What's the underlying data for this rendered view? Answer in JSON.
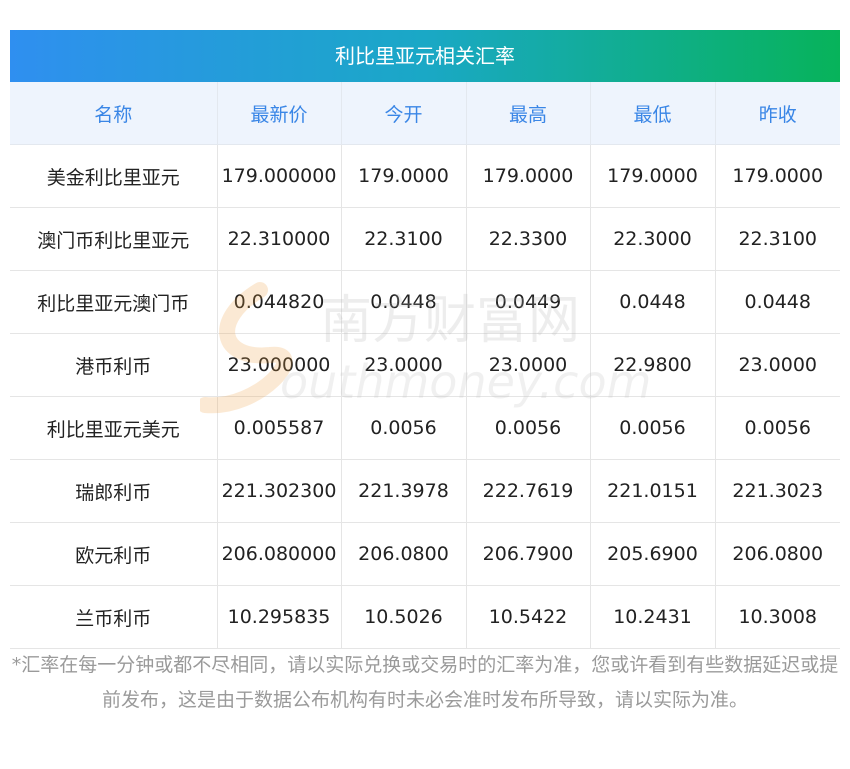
{
  "table": {
    "title": "利比里亚元相关汇率",
    "columns": [
      "名称",
      "最新价",
      "今开",
      "最高",
      "最低",
      "昨收"
    ],
    "rows": [
      [
        "美金利比里亚元",
        "179.000000",
        "179.0000",
        "179.0000",
        "179.0000",
        "179.0000"
      ],
      [
        "澳门币利比里亚元",
        "22.310000",
        "22.3100",
        "22.3300",
        "22.3000",
        "22.3100"
      ],
      [
        "利比里亚元澳门币",
        "0.044820",
        "0.0448",
        "0.0449",
        "0.0448",
        "0.0448"
      ],
      [
        "港币利币",
        "23.000000",
        "23.0000",
        "23.0000",
        "22.9800",
        "23.0000"
      ],
      [
        "利比里亚元美元",
        "0.005587",
        "0.0056",
        "0.0056",
        "0.0056",
        "0.0056"
      ],
      [
        "瑞郎利币",
        "221.302300",
        "221.3978",
        "222.7619",
        "221.0151",
        "221.3023"
      ],
      [
        "欧元利币",
        "206.080000",
        "206.0800",
        "206.7900",
        "205.6900",
        "206.0800"
      ],
      [
        "兰币利币",
        "10.295835",
        "10.5026",
        "10.5422",
        "10.2431",
        "10.3008"
      ]
    ]
  },
  "note": "*汇率在每一分钟或都不尽相同，请以实际兑换或交易时的汇率为准，您或许看到有些数据延迟或提前发布，这是由于数据公布机构有时未必会准时发布所导致，请以实际为准。",
  "watermark": {
    "cn": "南方财富网",
    "en": "outhmoney.com"
  },
  "colors": {
    "header_text": "#3a86e6",
    "header_bg": "#eef4fd",
    "title_gradient_start": "#2f8ff0",
    "title_gradient_end": "#07b35a"
  }
}
